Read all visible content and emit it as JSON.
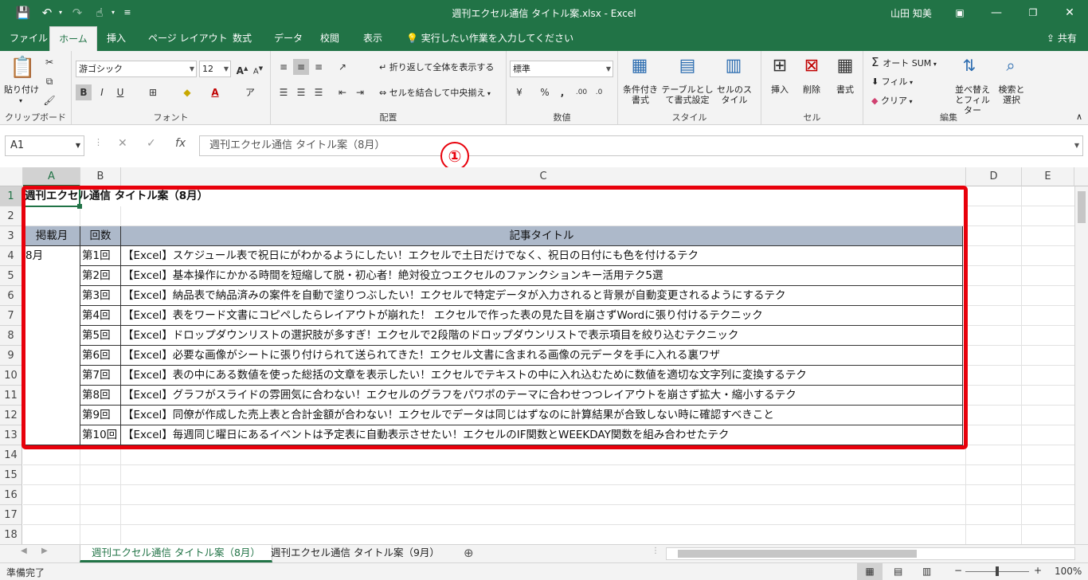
{
  "window": {
    "doc_title": "週刊エクセル通信 タイトル案.xlsx - Excel",
    "user": "山田 知美"
  },
  "tabs": [
    {
      "label": "ファイル"
    },
    {
      "label": "ホーム"
    },
    {
      "label": "挿入"
    },
    {
      "label": "ページ レイアウト"
    },
    {
      "label": "数式"
    },
    {
      "label": "データ"
    },
    {
      "label": "校閲"
    },
    {
      "label": "表示"
    }
  ],
  "tell_me": "実行したい作業を入力してください",
  "share": "共有",
  "ribbon": {
    "clipboard": {
      "paste": "貼り付け",
      "label": "クリップボード"
    },
    "font": {
      "name": "游ゴシック",
      "size": "12",
      "bold": "B",
      "italic": "I",
      "underline": "U",
      "label": "フォント"
    },
    "alignment": {
      "wrap": "折り返して全体を表示する",
      "merge": "セルを結合して中央揃え",
      "label": "配置"
    },
    "number": {
      "format": "標準",
      "percent": "%",
      "comma": ",",
      "label": "数値"
    },
    "styles": {
      "conditional": "条件付き書式",
      "table": "テーブルとして書式設定",
      "cell": "セルのスタイル",
      "label": "スタイル"
    },
    "cells": {
      "insert": "挿入",
      "delete": "削除",
      "format": "書式",
      "label": "セル"
    },
    "editing": {
      "autosum": "オート SUM",
      "fill": "フィル",
      "clear": "クリア",
      "sort": "並べ替えとフィルター",
      "find": "検索と選択",
      "label": "編集"
    }
  },
  "formula": {
    "name_box": "A1",
    "fx": "fx",
    "value": "週刊エクセル通信 タイトル案（8月）"
  },
  "annotation": "①",
  "columns": [
    "A",
    "B",
    "C",
    "D",
    "E"
  ],
  "rows": [
    "1",
    "2",
    "3",
    "4",
    "5",
    "6",
    "7",
    "8",
    "9",
    "10",
    "11",
    "12",
    "13",
    "14",
    "15",
    "16",
    "17",
    "18"
  ],
  "sheet": {
    "title": "週刊エクセル通信 タイトル案（8月）",
    "headers": [
      "掲載月",
      "回数",
      "記事タイトル"
    ],
    "month": "8月",
    "articles": [
      {
        "no": "第1回",
        "title": "【Excel】スケジュール表で祝日にがわかるようにしたい！エクセルで土日だけでなく、祝日の日付にも色を付けるテク"
      },
      {
        "no": "第2回",
        "title": "【Excel】基本操作にかかる時間を短縮して脱・初心者！絶対役立つエクセルのファンクションキー活用テク5選"
      },
      {
        "no": "第3回",
        "title": "【Excel】納品表で納品済みの案件を自動で塗りつぶしたい！エクセルで特定データが入力されると背景が自動変更されるようにするテク"
      },
      {
        "no": "第4回",
        "title": "【Excel】表をワード文書にコピペしたらレイアウトが崩れた！ エクセルで作った表の見た目を崩さずWordに張り付けるテクニック"
      },
      {
        "no": "第5回",
        "title": "【Excel】ドロップダウンリストの選択肢が多すぎ！エクセルで2段階のドロップダウンリストで表示項目を絞り込むテクニック"
      },
      {
        "no": "第6回",
        "title": "【Excel】必要な画像がシートに張り付けられて送られてきた！エクセル文書に含まれる画像の元データを手に入れる裏ワザ"
      },
      {
        "no": "第7回",
        "title": "【Excel】表の中にある数値を使った総括の文章を表示したい！エクセルでテキストの中に入れ込むために数値を適切な文字列に変換するテク"
      },
      {
        "no": "第8回",
        "title": "【Excel】グラフがスライドの雰囲気に合わない！エクセルのグラフをパワポのテーマに合わせつつレイアウトを崩さず拡大・縮小するテク"
      },
      {
        "no": "第9回",
        "title": "【Excel】同僚が作成した売上表と合計金額が合わない！エクセルでデータは同じはずなのに計算結果が合致しない時に確認すべきこと"
      },
      {
        "no": "第10回",
        "title": "【Excel】毎週同じ曜日にあるイベントは予定表に自動表示させたい！エクセルのIF関数とWEEKDAY関数を組み合わせたテク"
      }
    ]
  },
  "sheet_tabs": [
    "週刊エクセル通信 タイトル案（8月）",
    "週刊エクセル通信 タイトル案（9月）"
  ],
  "status": {
    "text": "準備完了",
    "zoom": "100%"
  },
  "colors": {
    "accent": "#217346",
    "header_fill": "#adb9ca",
    "highlight": "#e8000b"
  }
}
